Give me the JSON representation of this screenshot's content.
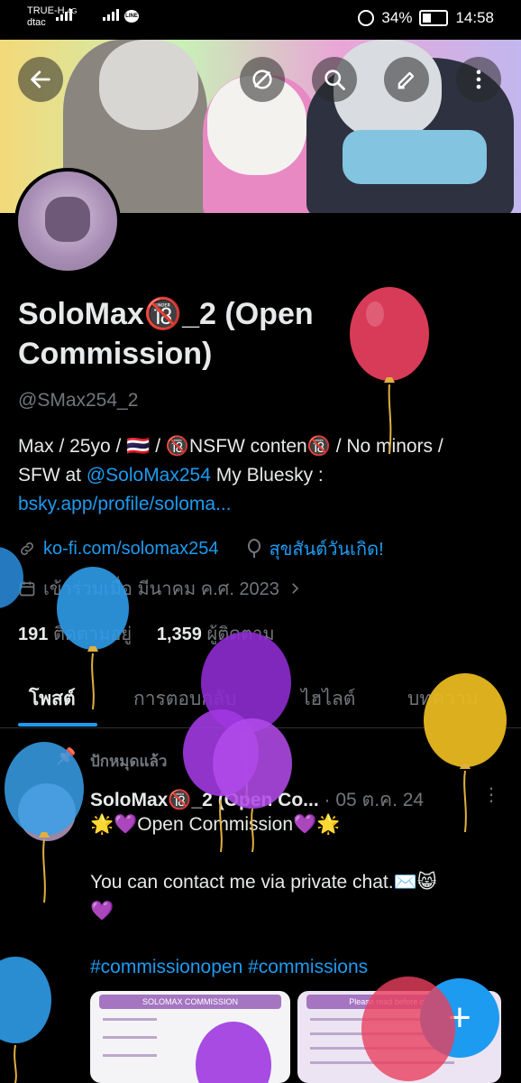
{
  "status_bar": {
    "carrier1": "TRUE-H",
    "carrier2": "dtac",
    "network": "4G",
    "line_badge": "LINE",
    "battery": "34%",
    "time": "14:58"
  },
  "header_icons": {
    "back": "arrow-left-icon",
    "unblock": "slash-circle-icon",
    "search": "search-icon",
    "edit": "edit-icon",
    "more": "more-vertical-icon"
  },
  "profile": {
    "name_line1": "SoloMax🔞_2 (Open",
    "name_line2": "Commission)",
    "handle": "@SMax254_2",
    "bio_text": "Max / 25yo / 🇹🇭 / 🔞NSFW conten🔞 / No minors / SFW at ",
    "bio_mention": "@SoloMax254",
    "bio_after": "  My Bluesky :",
    "bio_link": "bsky.app/profile/soloma...",
    "website": "ko-fi.com/solomax254",
    "birthday": "สุขสันต์วันเกิด!",
    "joined": "เข้าร่วมเมื่อ มีนาคม ค.ศ. 2023",
    "following_count": "191",
    "following_label": "ติดตามอยู่",
    "followers_count": "1,359",
    "followers_label": "ผู้ติดตาม"
  },
  "tabs": [
    {
      "label": "โพสต์"
    },
    {
      "label": "การตอบกลับ"
    },
    {
      "label": "ไฮไลต์"
    },
    {
      "label": "บทความ"
    }
  ],
  "post": {
    "pinned_label": "ปักหมุดแล้ว",
    "author": "SoloMax🔞_2 (Open Co...",
    "date": "· 05 ต.ค. 24",
    "line1": "🌟💜Open Commission💜🌟",
    "line2": "You can contact me via private chat.✉️😸",
    "line3": "💜",
    "hashtags": "#commissionopen #commissions",
    "media1_title": "SOLOMAX COMMISSION",
    "media2_title": "Please read before ordering"
  },
  "fab_label": "+",
  "colors": {
    "accent": "#1d9bf0",
    "background": "#000000",
    "text_secondary": "#71767b"
  }
}
